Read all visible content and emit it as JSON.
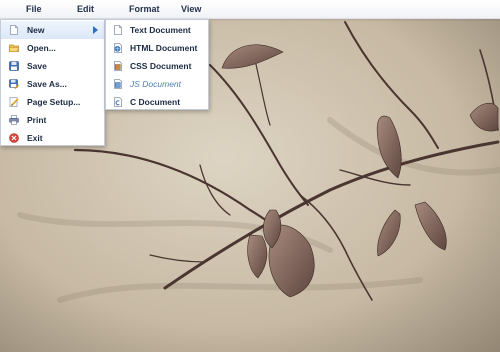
{
  "menubar": {
    "items": [
      "File",
      "Edit",
      "Format",
      "View"
    ]
  },
  "file_menu": {
    "items": [
      {
        "label": "New",
        "icon": "new-document-icon"
      },
      {
        "label": "Open...",
        "icon": "open-folder-icon"
      },
      {
        "label": "Save",
        "icon": "save-disk-icon"
      },
      {
        "label": "Save As...",
        "icon": "save-as-icon"
      },
      {
        "label": "Page Setup...",
        "icon": "page-setup-icon"
      },
      {
        "label": "Print",
        "icon": "printer-icon"
      },
      {
        "label": "Exit",
        "icon": "exit-icon"
      }
    ]
  },
  "new_submenu": {
    "items": [
      {
        "label": "Text Document",
        "icon": "text-document-icon"
      },
      {
        "label": "HTML Document",
        "icon": "html-document-icon"
      },
      {
        "label": "CSS Document",
        "icon": "css-document-icon"
      },
      {
        "label": "JS Document",
        "icon": "js-document-icon"
      },
      {
        "label": "C Document",
        "icon": "c-document-icon"
      }
    ]
  },
  "colors": {
    "accent": "#2f6fc2",
    "menu_text": "#1c2b44",
    "highlight": "#dce8f8",
    "disabled_text": "#4f7fb8"
  }
}
